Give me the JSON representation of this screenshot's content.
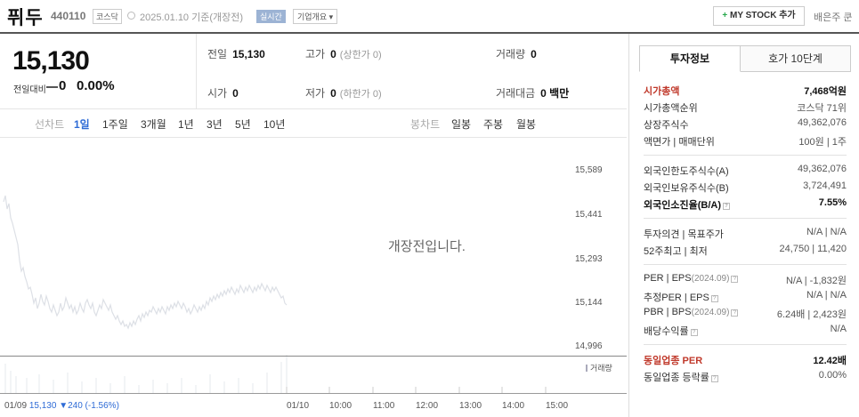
{
  "header": {
    "name": "퓌두",
    "code": "440110",
    "market": "코스닥",
    "date": "2025.01.10",
    "date_suffix": "기준(개장전)",
    "badge_live": "실시간",
    "badge_corp": "기업개요 ▾",
    "mystock_plus": "+",
    "mystock_label": "MY STOCK 추가",
    "stock_c": "배은주 쿤"
  },
  "price": {
    "current": "15,130",
    "diff_label": "전일대비",
    "diff_value": "0",
    "diff_pct": "0.00%"
  },
  "stats": {
    "prev_label": "전일",
    "prev_value": "15,130",
    "high_label": "고가",
    "high_value": "0",
    "high_limit": "(상한가 0)",
    "volume_label": "거래량",
    "volume_value": "0",
    "open_label": "시가",
    "open_value": "0",
    "low_label": "저가",
    "low_value": "0",
    "low_limit": "(하한가 0)",
    "amount_label": "거래대금",
    "amount_value": "0 백만"
  },
  "toolbar": {
    "line_label": "선차트",
    "periods": [
      "1일",
      "1주일",
      "3개월",
      "1년",
      "3년",
      "5년",
      "10년"
    ],
    "active_period": "1일",
    "candle_label": "봉차트",
    "candles": [
      "일봉",
      "주봉",
      "월봉"
    ]
  },
  "chart": {
    "message": "개장전입니다.",
    "y_ticks": [
      "15,589",
      "15,441",
      "15,293",
      "15,144",
      "14,996"
    ],
    "volume_legend": "거래량",
    "x_first_date": "01/09",
    "x_first_price": "15,130",
    "x_first_change": "▼240 (-1.56%)",
    "x_labels": [
      "01/10",
      "10:00",
      "11:00",
      "12:00",
      "13:00",
      "14:00",
      "15:00"
    ]
  },
  "panel": {
    "tab_info": "투자정보",
    "tab_orderbook": "호가 10단계",
    "market_cap_label": "시가총액",
    "market_cap_value": "7,468억원",
    "cap_rank_label": "시가총액순위",
    "cap_rank_value": "코스닥 71위",
    "listed_label": "상장주식수",
    "listed_value": "49,362,076",
    "par_label": "액면가 | 매매단위",
    "par_value": "100원 | 1주",
    "foreign_limit_label": "외국인한도주식수(A)",
    "foreign_limit_value": "49,362,076",
    "foreign_hold_label": "외국인보유주식수(B)",
    "foreign_hold_value": "3,724,491",
    "foreign_rate_label": "외국인소진율(B/A)",
    "foreign_rate_value": "7.55%",
    "opinion_label": "투자의견 | 목표주가",
    "opinion_value": "N/A | N/A",
    "w52_label": "52주최고 | 최저",
    "w52_value": "24,750 | 11,420",
    "per_label": "PER | EPS",
    "per_sub": "(2024.09)",
    "per_value": "N/A | -1,832원",
    "est_per_label": "추정PER | EPS",
    "est_per_value": "N/A | N/A",
    "pbr_label": "PBR | BPS",
    "pbr_sub": "(2024.09)",
    "pbr_value": "6.24배 | 2,423원",
    "div_label": "배당수익률",
    "div_value": "N/A",
    "sector_per_label": "동일업종 PER",
    "sector_per_value": "12.42배",
    "sector_rate_label": "동일업종 등락률",
    "sector_rate_value": "0.00%",
    "help_glyph": "?"
  }
}
